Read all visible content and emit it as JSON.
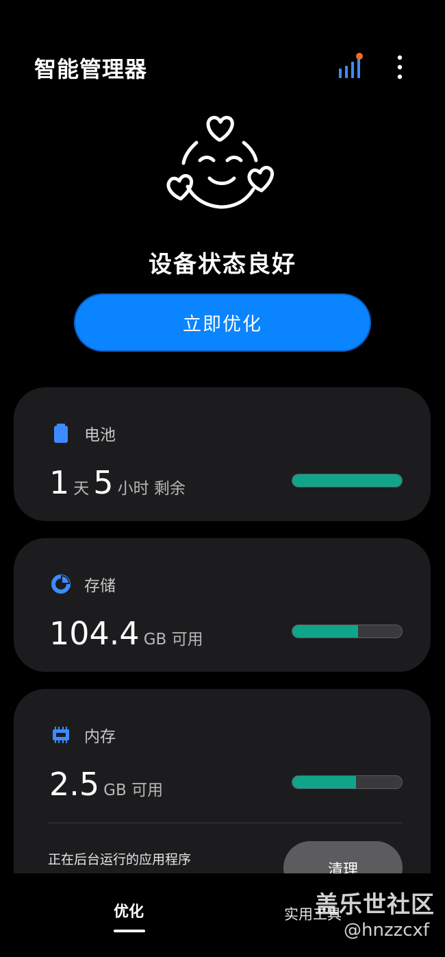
{
  "header": {
    "title": "智能管理器"
  },
  "status": {
    "text": "设备状态良好"
  },
  "optimize_button": {
    "label": "立即优化"
  },
  "battery": {
    "label": "电池",
    "days_value": "1",
    "days_unit": "天",
    "hours_value": "5",
    "hours_unit": "小时 剩余",
    "level_percent": 100
  },
  "storage": {
    "label": "存储",
    "value": "104.4",
    "unit": "GB 可用",
    "level_percent": 60
  },
  "memory": {
    "label": "内存",
    "value": "2.5",
    "unit": "GB 可用",
    "level_percent": 58,
    "background_apps_label": "正在后台运行的应用程序",
    "clean_button": "清理"
  },
  "bottom_nav": {
    "optimize": "优化",
    "tools": "实用工具"
  },
  "watermark": {
    "title": "盖乐世社区",
    "user": "@hnzzcxf"
  },
  "colors": {
    "accent": "#0a84ff",
    "bar_fill": "#10a58b",
    "card_bg": "#1c1c1e",
    "icon_blue": "#3d8bff",
    "badge_orange": "#f26b21"
  },
  "icons": [
    "stats-icon",
    "more-icon",
    "happy-face-icon",
    "battery-icon",
    "storage-pie-icon",
    "memory-chip-icon"
  ]
}
